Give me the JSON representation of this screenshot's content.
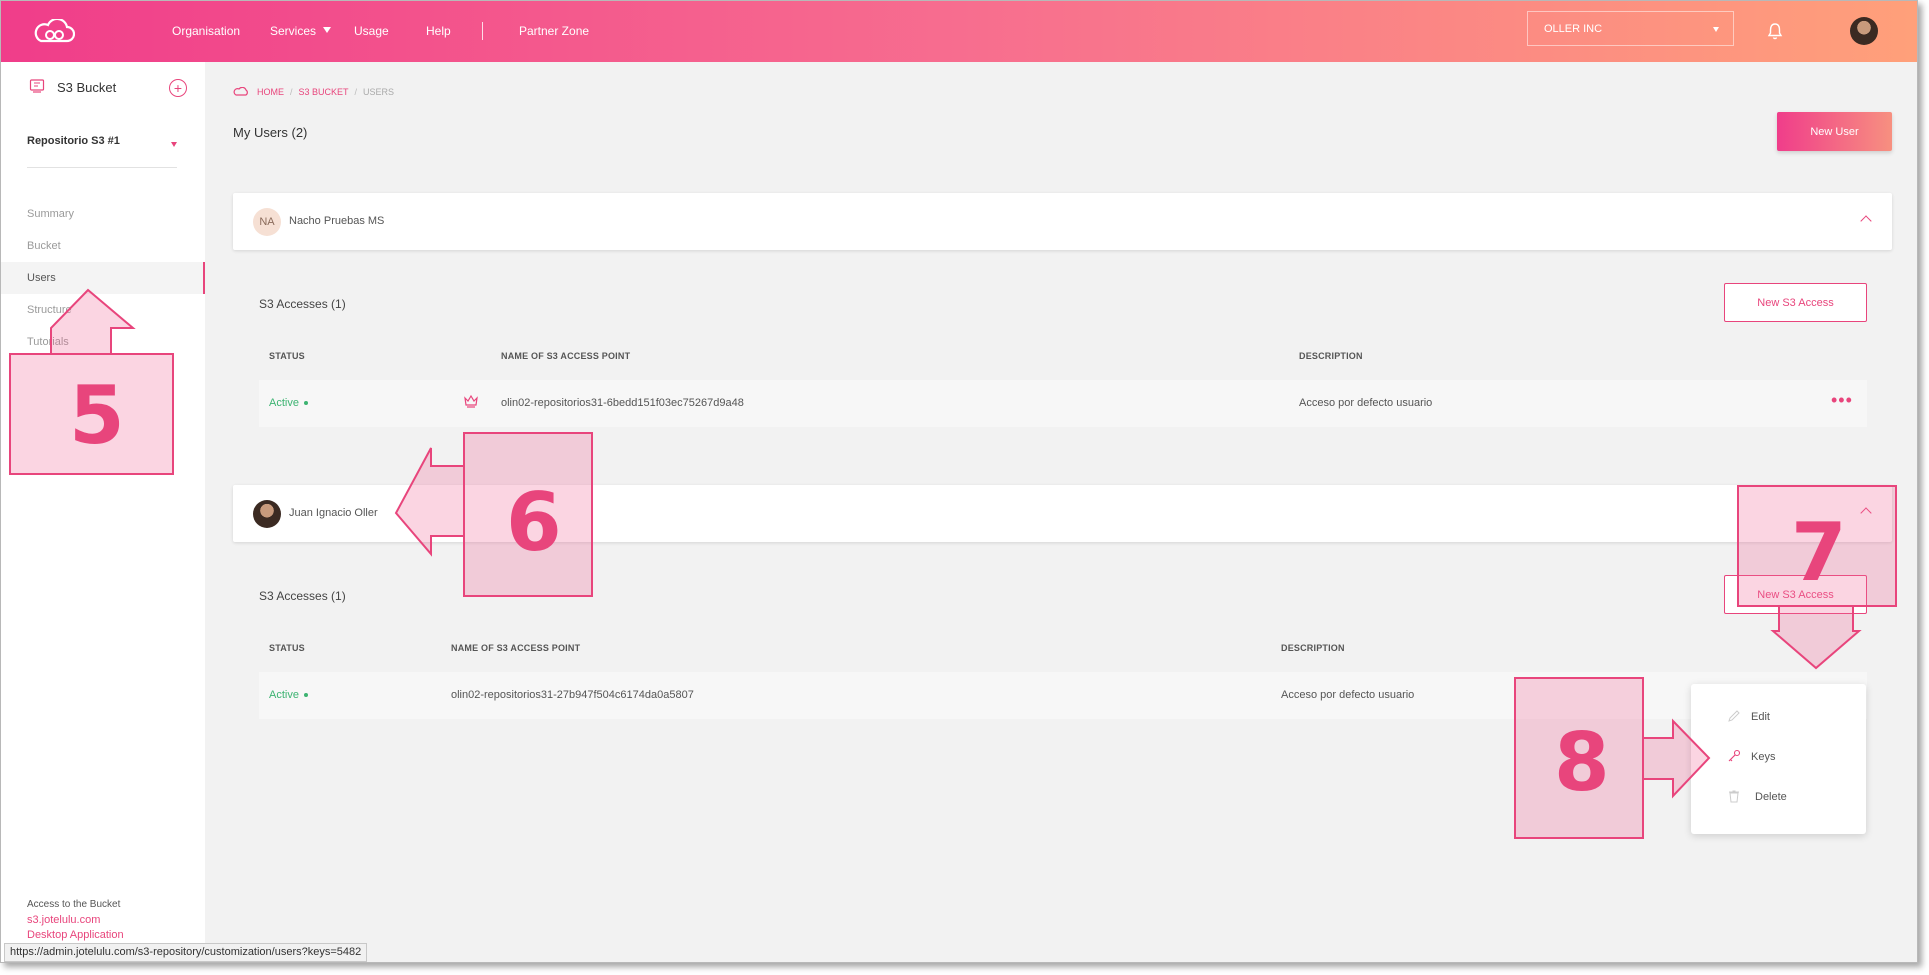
{
  "topbar": {
    "nav": [
      "Organisation",
      "Services",
      "Usage",
      "Help",
      "Partner Zone"
    ],
    "org_select": "OLLER INC"
  },
  "sidebar": {
    "title": "S3 Bucket",
    "repository": "Repositorio S3 #1",
    "items": [
      "Summary",
      "Bucket",
      "Users",
      "Structure",
      "Tutorials"
    ],
    "active_item": "Users",
    "footer_label": "Access to the Bucket",
    "footer_links": [
      "s3.jotelulu.com",
      "Desktop Application"
    ]
  },
  "breadcrumb": {
    "home": "HOME",
    "section": "S3 BUCKET",
    "current": "USERS"
  },
  "main": {
    "title": "My Users (2)",
    "new_user_label": "New User",
    "users": [
      {
        "initials": "NA",
        "name": "Nacho Pruebas MS",
        "accesses_title": "S3 Accesses (1)",
        "new_access_label": "New S3 Access",
        "columns": [
          "STATUS",
          "NAME OF S3 ACCESS POINT",
          "DESCRIPTION"
        ],
        "rows": [
          {
            "status": "Active",
            "name": "olin02-repositorios31-6bedd151f03ec75267d9a48",
            "description": "Acceso por defecto usuario"
          }
        ]
      },
      {
        "initials": "",
        "name": "Juan Ignacio Oller",
        "accesses_title": "S3 Accesses (1)",
        "new_access_label": "New S3 Access",
        "columns": [
          "STATUS",
          "NAME OF S3 ACCESS POINT",
          "DESCRIPTION"
        ],
        "rows": [
          {
            "status": "Active",
            "name": "olin02-repositorios31-27b947f504c6174da0a5807",
            "description": "Acceso por defecto usuario"
          }
        ]
      }
    ]
  },
  "dropdown": {
    "items": [
      "Edit",
      "Keys",
      "Delete"
    ]
  },
  "callouts": [
    "5",
    "6",
    "7",
    "8"
  ],
  "status_url": "https://admin.jotelulu.com/s3-repository/customization/users?keys=5482",
  "colors": {
    "accent": "#e8457c",
    "gradient_start": "#f03d8a",
    "gradient_end": "#ffa07a",
    "active_status": "#3cb371"
  }
}
